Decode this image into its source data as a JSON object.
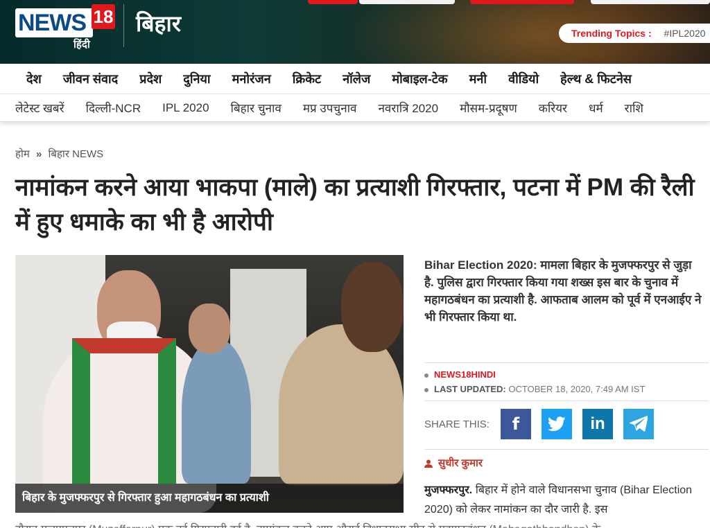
{
  "header": {
    "logo_brand": "NEWS",
    "logo_number": "18",
    "logo_language": "हिंदी",
    "state_title": "बिहार",
    "trending_label": "Trending Topics :",
    "trending_tag": "#IPL2020"
  },
  "primary_nav": [
    "देश",
    "जीवन संवाद",
    "प्रदेश",
    "दुनिया",
    "मनोरंजन",
    "क्रिकेट",
    "नॉलेज",
    "मोबाइल-टेक",
    "मनी",
    "वीडियो",
    "हेल्थ & फिटनेस"
  ],
  "secondary_nav": [
    "लेटेस्ट खबरें",
    "दिल्ली-NCR",
    "IPL 2020",
    "बिहार चुनाव",
    "मप्र उपचुनाव",
    "नवरात्रि 2020",
    "मौसम-प्रदूषण",
    "करियर",
    "धर्म",
    "राशि"
  ],
  "breadcrumb": {
    "home": "होम",
    "separator": "»",
    "section": "बिहार NEWS"
  },
  "article": {
    "headline": "नामांकन करने आया भाकपा (माले) का प्रत्याशी गिरफ्तार, पटना में PM की रैली में हुए धमाके का भी है आरोपी",
    "photo_caption": "बिहार के मुजफ्फरपुर से गिरफ्तार हुआ महागठबंधन का प्रत्याशी",
    "summary": "Bihar Election 2020: मामला बिहार के मुजफ्फरपुर से जुड़ा है. पुलिस द्वारा गिरफ्तार किया गया शख्स इस बार के चुनाव में महागठबंधन का प्रत्याशी है. आफताब आलम को पूर्व में एनआईए ने भी गिरफ्तार किया था.",
    "source": "NEWS18HINDI",
    "updated_label": "LAST UPDATED:",
    "updated_value": "OCTOBER 18, 2020, 7:49 AM IST",
    "share_label": "SHARE THIS:",
    "author": "सुधीर कुमार",
    "body_dateline": "मुजफ्फरपुर.",
    "body_text": "बिहार में होने वाले विधानसभा चुनाव (Bihar Election 2020) को लेकर नामांकन का दौर जारी है. इस",
    "body_cut": "दौरान मुजफ्फरपुर (Muzaffarpur) एक नई गिरफ्तारी हुई है. नामांकन करने आए औराई विधानसभा सीट से महागठबंधन (Mahagathbandhan) के"
  },
  "share_buttons": [
    {
      "name": "facebook",
      "glyph": "f",
      "color": "#3b5998"
    },
    {
      "name": "twitter",
      "glyph": "🐦",
      "color": "#1da1f2"
    },
    {
      "name": "linkedin",
      "glyph": "in",
      "color": "#0e76a8"
    },
    {
      "name": "telegram",
      "glyph": "➤",
      "color": "#2ca5e0"
    }
  ],
  "colors": {
    "brand_red": "#e0181e",
    "header_dark": "#0d3a36"
  }
}
